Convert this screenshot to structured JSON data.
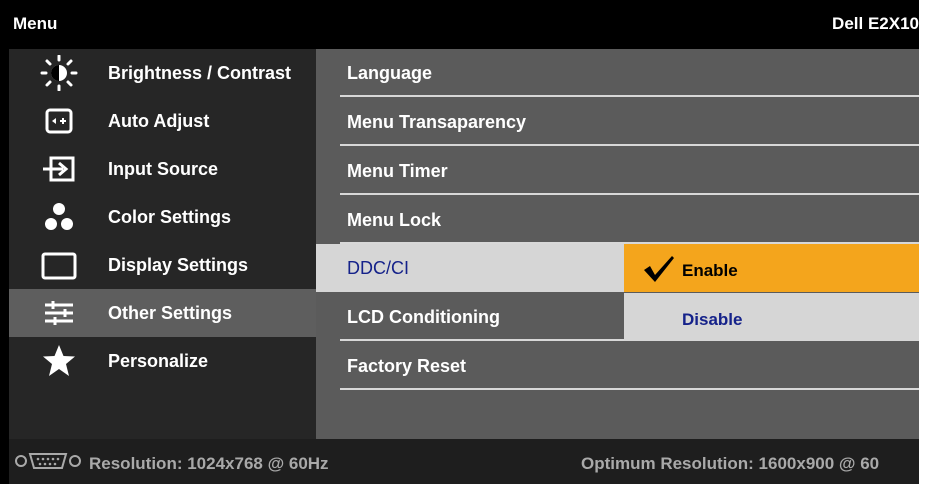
{
  "header": {
    "title": "Menu",
    "model": "Dell E2X10"
  },
  "left_menu": [
    {
      "label": "Brightness / Contrast",
      "icon": "brightness-icon"
    },
    {
      "label": "Auto Adjust",
      "icon": "auto-adjust-icon"
    },
    {
      "label": "Input Source",
      "icon": "input-source-icon"
    },
    {
      "label": "Color Settings",
      "icon": "color-settings-icon"
    },
    {
      "label": "Display Settings",
      "icon": "display-settings-icon"
    },
    {
      "label": "Other Settings",
      "icon": "sliders-icon",
      "active": true
    },
    {
      "label": "Personalize",
      "icon": "star-icon"
    }
  ],
  "right_menu": [
    {
      "label": "Language"
    },
    {
      "label": "Menu Transaparency"
    },
    {
      "label": "Menu Timer"
    },
    {
      "label": "Menu Lock"
    },
    {
      "label": "DDC/CI",
      "selected": true
    },
    {
      "label": "LCD Conditioning"
    },
    {
      "label": "Factory Reset"
    }
  ],
  "submenu": {
    "enable": "Enable",
    "disable": "Disable",
    "checked": "Enable"
  },
  "footer": {
    "resolution": "Resolution: 1024x768 @ 60Hz",
    "optimum": "Optimum Resolution: 1600x900 @ 60"
  },
  "colors": {
    "highlight": "#f4a51c",
    "selected_text": "#15228a"
  }
}
